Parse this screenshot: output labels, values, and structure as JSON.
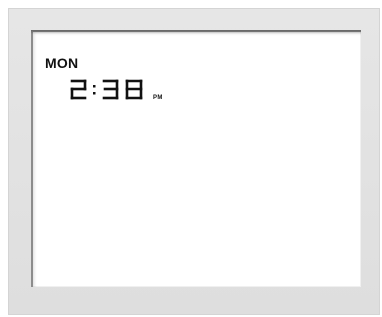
{
  "display": {
    "day": "MON",
    "time": {
      "hour": "2",
      "separator": ":",
      "minutes": "38",
      "period": "PM"
    }
  },
  "colors": {
    "frame": "#e2e2e2",
    "screen": "#ffffff",
    "segment": "#111111"
  },
  "icons": {
    "colon": "colon-separator-icon"
  }
}
